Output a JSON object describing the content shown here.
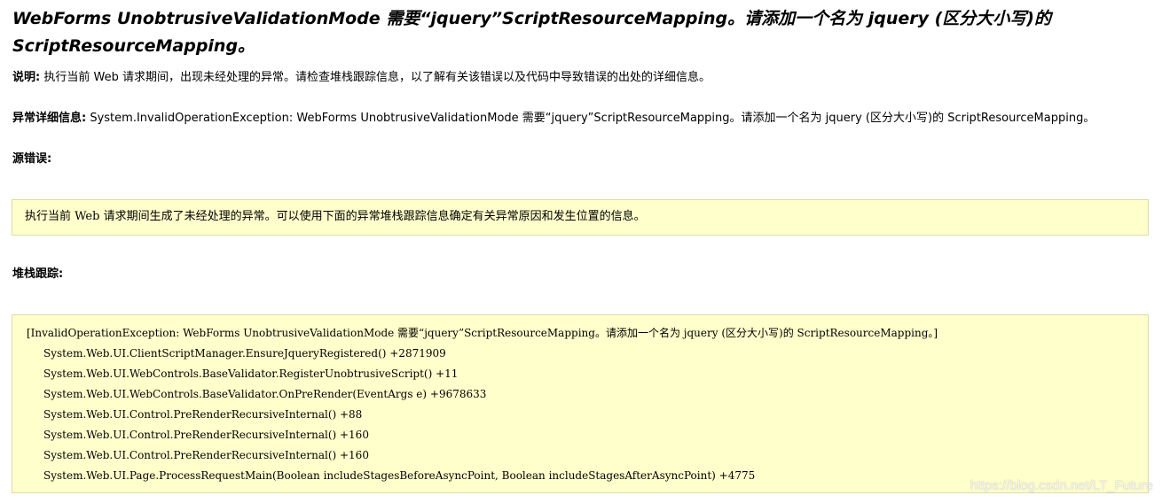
{
  "error_page": {
    "title": "WebForms UnobtrusiveValidationMode 需要“jquery”ScriptResourceMapping。请添加一个名为 jquery (区分大小写)的 ScriptResourceMapping。",
    "description_label": "说明:",
    "description_text": "执行当前 Web 请求期间，出现未经处理的异常。请检查堆栈跟踪信息，以了解有关该错误以及代码中导致错误的出处的详细信息。",
    "exception_label": "异常详细信息:",
    "exception_text": "System.InvalidOperationException: WebForms UnobtrusiveValidationMode 需要“jquery”ScriptResourceMapping。请添加一个名为 jquery (区分大小写)的 ScriptResourceMapping。",
    "source_error_heading": "源错误:",
    "source_error_text": "执行当前 Web 请求期间生成了未经处理的异常。可以使用下面的异常堆栈跟踪信息确定有关异常原因和发生位置的信息。",
    "stack_trace_heading": "堆栈跟踪:",
    "stack_trace": [
      "[InvalidOperationException: WebForms UnobtrusiveValidationMode 需要“jquery”ScriptResourceMapping。请添加一个名为 jquery (区分大小写)的 ScriptResourceMapping。]",
      "System.Web.UI.ClientScriptManager.EnsureJqueryRegistered() +2871909",
      "System.Web.UI.WebControls.BaseValidator.RegisterUnobtrusiveScript() +11",
      "System.Web.UI.WebControls.BaseValidator.OnPreRender(EventArgs e) +9678633",
      "System.Web.UI.Control.PreRenderRecursiveInternal() +88",
      "System.Web.UI.Control.PreRenderRecursiveInternal() +160",
      "System.Web.UI.Control.PreRenderRecursiveInternal() +160",
      "System.Web.UI.Page.ProcessRequestMain(Boolean includeStagesBeforeAsyncPoint, Boolean includeStagesAfterAsyncPoint) +4775"
    ]
  },
  "watermark": "https://blog.csdn.net/LT_Future",
  "colors": {
    "code_background": "#ffffcc",
    "code_border": "#dcdca8",
    "text": "#000000"
  }
}
